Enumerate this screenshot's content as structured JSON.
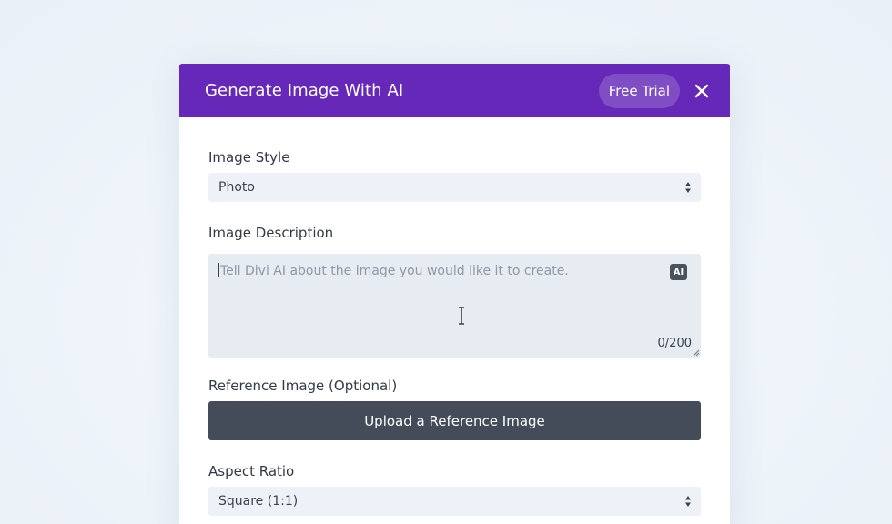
{
  "modal": {
    "title": "Generate Image With AI",
    "trial_label": "Free Trial",
    "close_icon": "close-icon",
    "accent_color": "#6528b8"
  },
  "form": {
    "image_style": {
      "label": "Image Style",
      "value": "Photo"
    },
    "image_description": {
      "label": "Image Description",
      "placeholder": "Tell Divi AI about the image you would like it to create.",
      "ai_badge": "AI",
      "counter": "0/200"
    },
    "reference_image": {
      "label": "Reference Image (Optional)",
      "button_label": "Upload a Reference Image"
    },
    "aspect_ratio": {
      "label": "Aspect Ratio",
      "value": "Square (1:1)"
    }
  }
}
